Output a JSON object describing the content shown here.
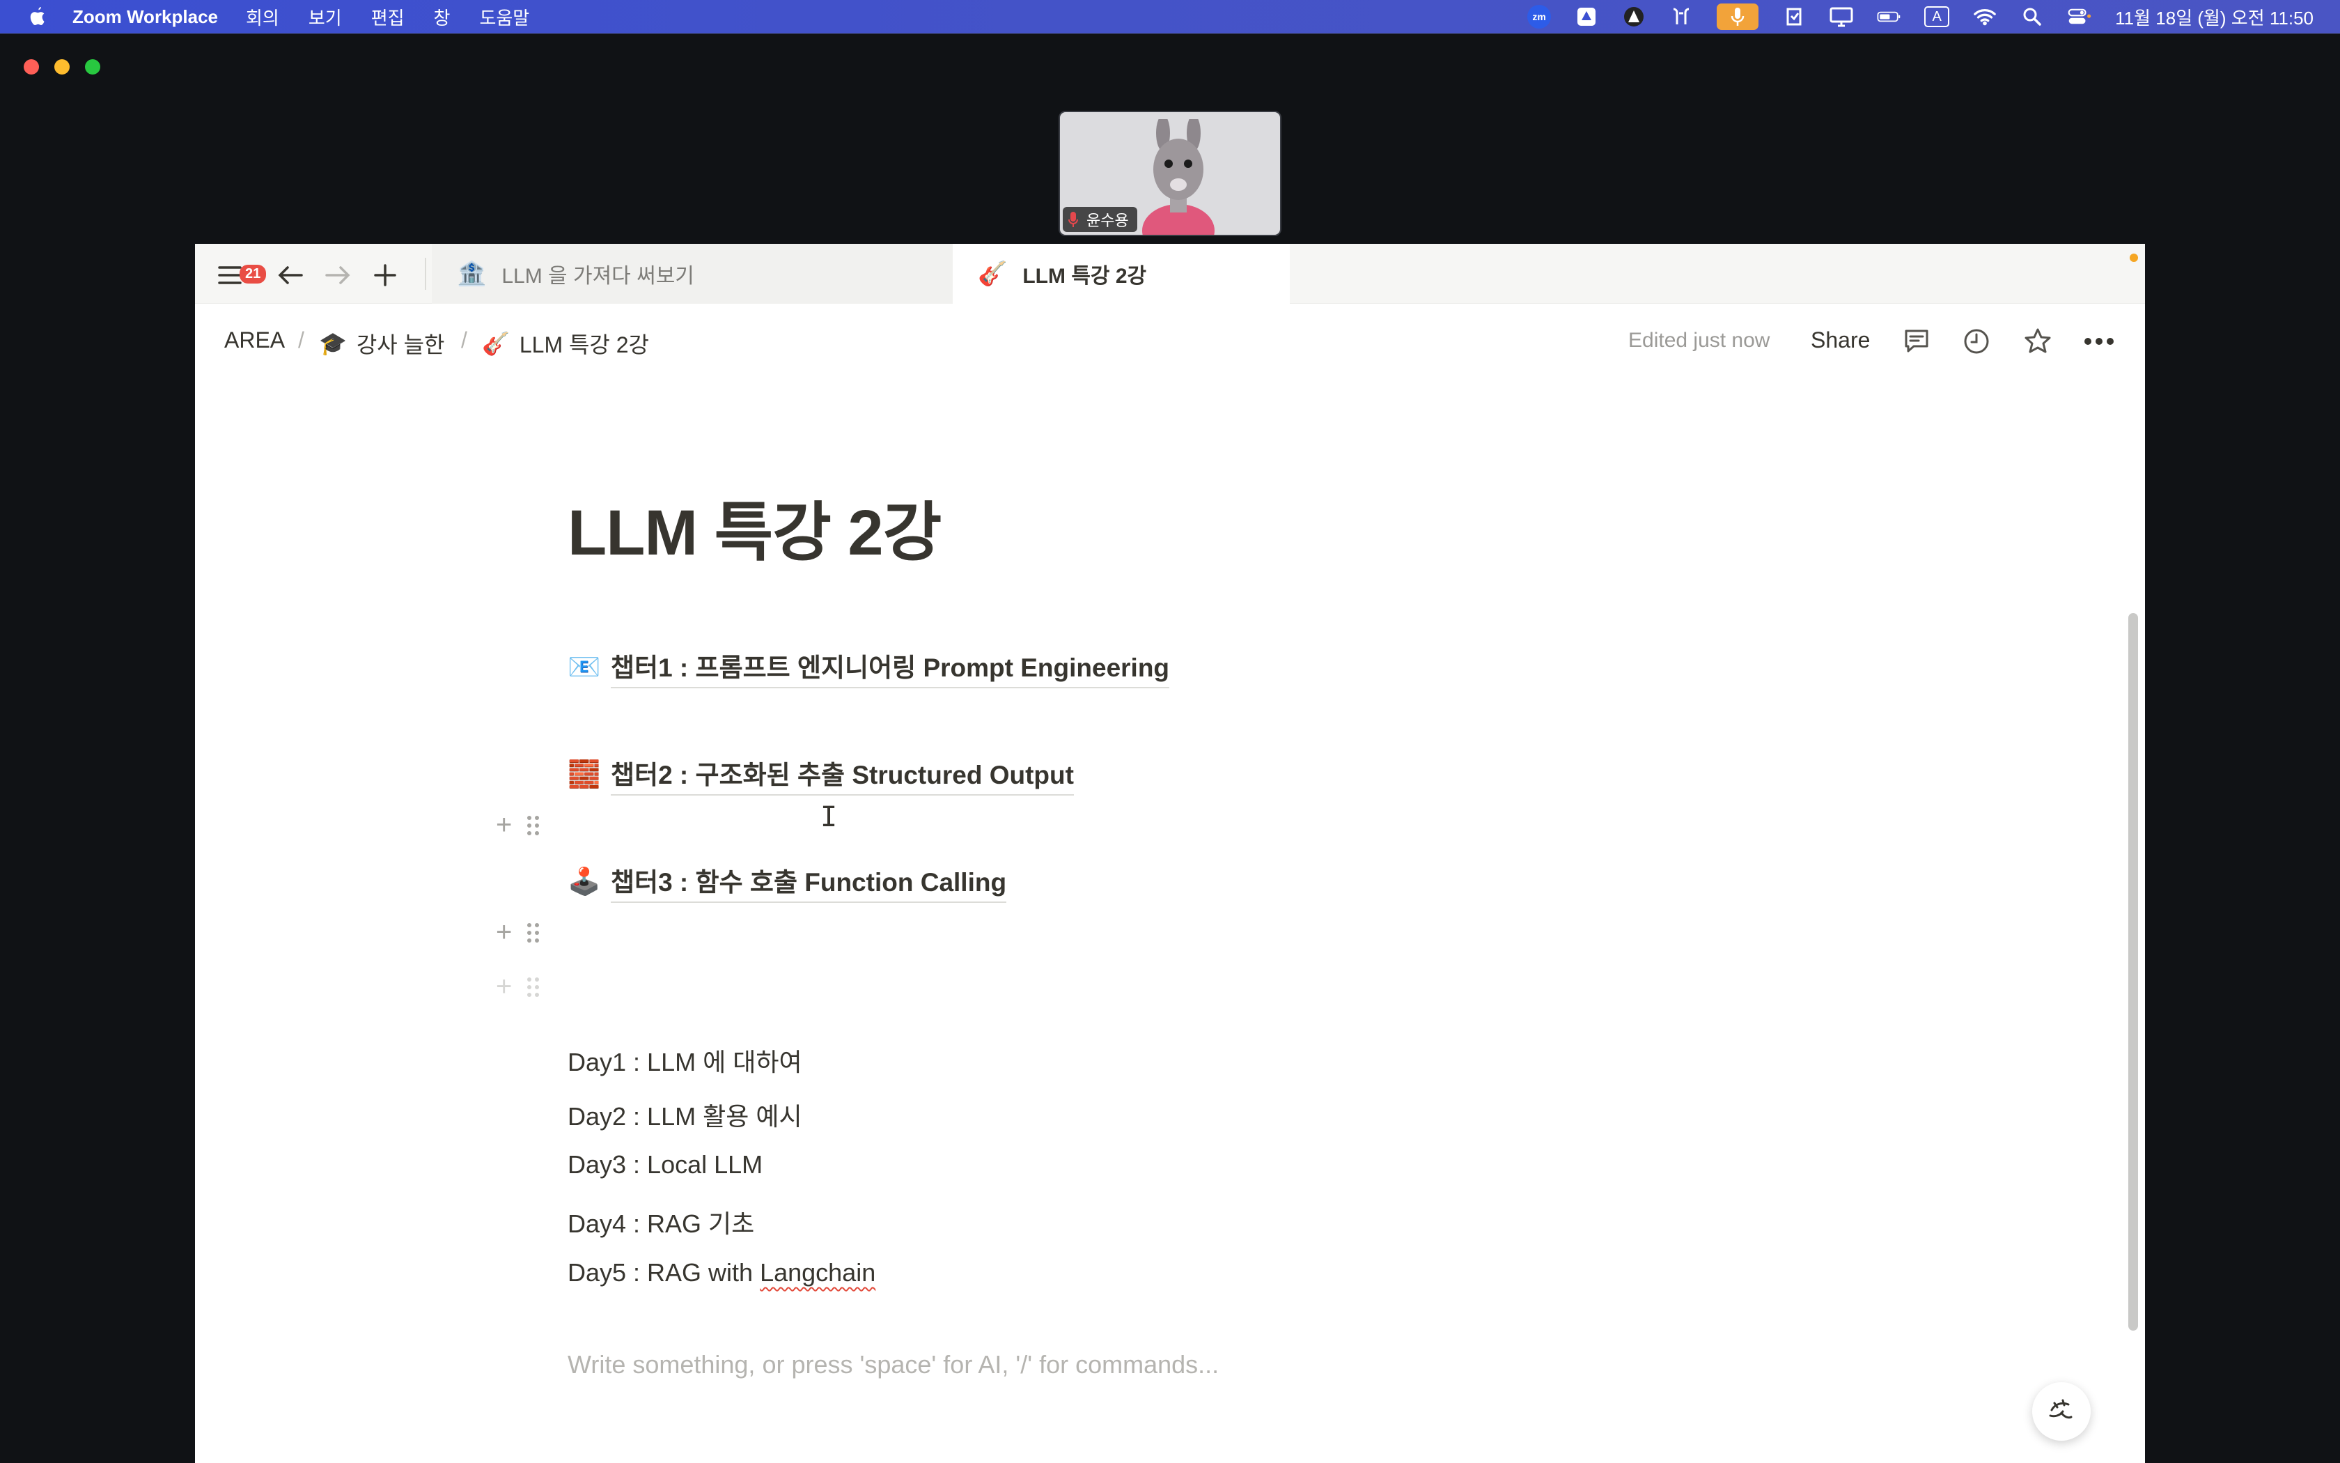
{
  "menubar": {
    "app_name": "Zoom Workplace",
    "menus": [
      "회의",
      "보기",
      "편집",
      "창",
      "도움말"
    ],
    "zoom_icon_label": "zm",
    "keyboard_label": "A",
    "clock": "11월 18일 (월) 오전 11:50"
  },
  "participant": {
    "name": "윤수용"
  },
  "notion": {
    "notification_count": "21",
    "tabs": [
      {
        "emoji": "🏦",
        "label": "LLM 을 가져다 써보기"
      },
      {
        "emoji": "🎸",
        "label": "LLM 특강 2강"
      }
    ],
    "breadcrumb": [
      {
        "emoji": "",
        "label": "AREA"
      },
      {
        "emoji": "🎓",
        "label": "강사 늘한"
      },
      {
        "emoji": "🎸",
        "label": "LLM 특강 2강"
      }
    ],
    "breadcrumb_separator": "/",
    "edited_label": "Edited just now",
    "share_label": "Share",
    "page_title": "LLM 특강 2강",
    "chapters": [
      {
        "emoji": "📧",
        "label": "챕터1 : 프롬프트 엔지니어링 Prompt Engineering"
      },
      {
        "emoji": "🧱",
        "label": "챕터2 : 구조화된 추출 Structured Output"
      },
      {
        "emoji": "🕹️",
        "label": "챕터3 : 함수 호출 Function Calling"
      }
    ],
    "days": [
      "Day1 : LLM 에 대하여",
      "Day2 : LLM 활용 예시",
      "Day3 : Local LLM",
      "Day4 : RAG 기초"
    ],
    "day5_prefix": "Day5 : RAG with ",
    "day5_word": "Langchain",
    "placeholder": "Write something, or press 'space' for AI, '/' for commands...",
    "text_cursor": "I"
  }
}
